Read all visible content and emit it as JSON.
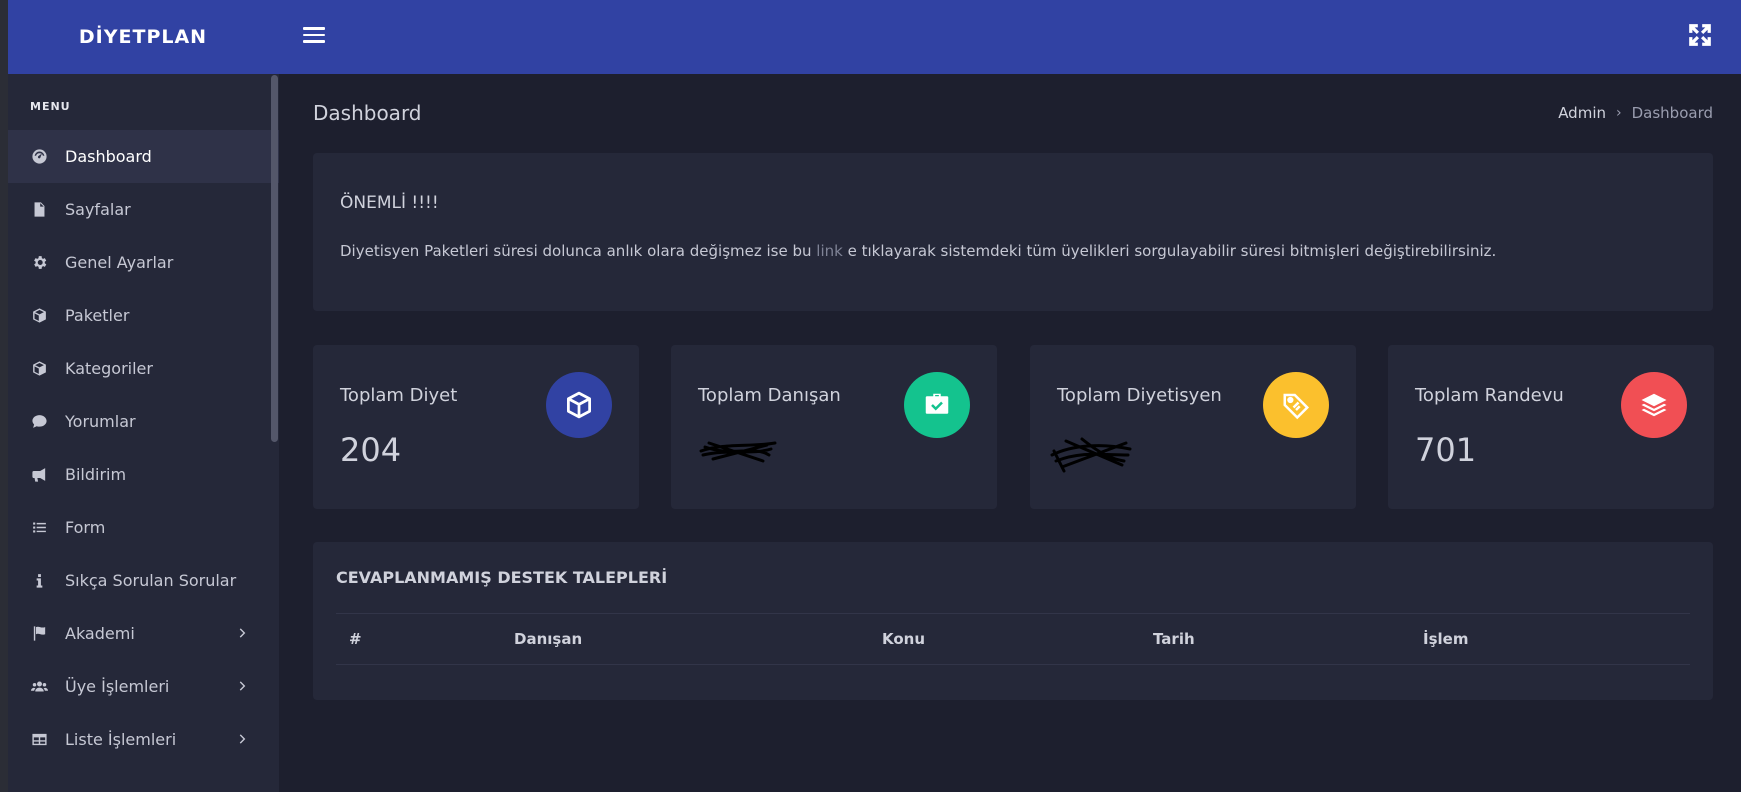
{
  "brand": "DİYETPLAN",
  "sidebar": {
    "menu_title": "MENU",
    "items": [
      {
        "label": "Dashboard",
        "icon": "dashboard-gauge-icon",
        "active": true
      },
      {
        "label": "Sayfalar",
        "icon": "file-icon"
      },
      {
        "label": "Genel Ayarlar",
        "icon": "gear-icon"
      },
      {
        "label": "Paketler",
        "icon": "box-icon"
      },
      {
        "label": "Kategoriler",
        "icon": "box-icon"
      },
      {
        "label": "Yorumlar",
        "icon": "comment-icon"
      },
      {
        "label": "Bildirim",
        "icon": "megaphone-icon"
      },
      {
        "label": "Form",
        "icon": "list-icon"
      },
      {
        "label": "Sıkça Sorulan Sorular",
        "icon": "info-icon"
      },
      {
        "label": "Akademi",
        "icon": "flag-icon",
        "has_children": true
      },
      {
        "label": "Üye İşlemleri",
        "icon": "users-icon",
        "has_children": true
      },
      {
        "label": "Liste İşlemleri",
        "icon": "table-icon",
        "has_children": true
      }
    ]
  },
  "header": {
    "page_title": "Dashboard",
    "breadcrumb": {
      "parent": "Admin",
      "current": "Dashboard"
    }
  },
  "notice": {
    "title": "ÖNEMLİ !!!!",
    "text_before": "Diyetisyen Paketleri süresi dolunca anlık olara değişmez ise bu ",
    "link": "link",
    "text_after": " e tıklayarak sistemdeki tüm üyelikleri sorgulayabilir süresi bitmişleri değiştirebilirsiniz."
  },
  "stats": [
    {
      "label": "Toplam Diyet",
      "value": "204",
      "icon": "cube-icon",
      "color": "#3142a3"
    },
    {
      "label": "Toplam Danışan",
      "value": "",
      "icon": "briefcase-check-icon",
      "color": "#14c38e"
    },
    {
      "label": "Toplam Diyetisyen",
      "value": "",
      "icon": "tag-icon",
      "color": "#fbc02d"
    },
    {
      "label": "Toplam Randevu",
      "value": "701",
      "icon": "layers-icon",
      "color": "#f14f54"
    }
  ],
  "support": {
    "title": "CEVAPLANMAMIŞ DESTEK TALEPLERİ",
    "columns": [
      "#",
      "Danışan",
      "Konu",
      "Tarih",
      "İşlem"
    ]
  }
}
